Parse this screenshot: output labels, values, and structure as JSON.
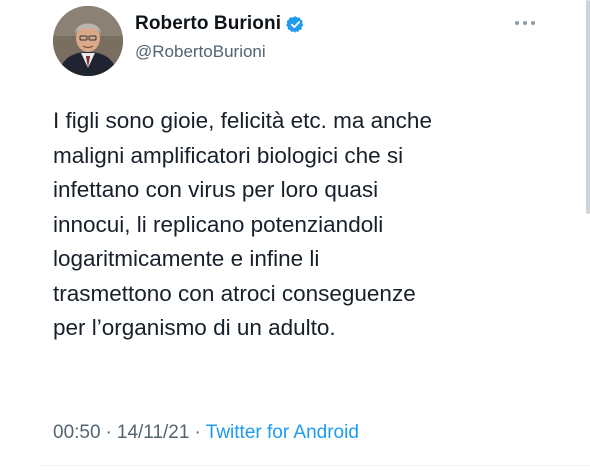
{
  "author": {
    "display_name": "Roberto Burioni",
    "handle": "@RobertoBurioni",
    "verified": true
  },
  "icons": {
    "verified": "verified-badge-icon",
    "more": "more-options-icon"
  },
  "tweet": {
    "text": "I figli sono gioie, felicità etc. ma anche\nmaligni amplificatori biologici che si\ninfettano con virus per loro quasi\ninnocui, li replicano potenziandoli\nlogaritmicamente e infine li\ntrasmettono con atroci conseguenze\nper l’organismo di un adulto."
  },
  "meta": {
    "time": "00:50",
    "separator": "·",
    "date": "14/11/21",
    "source": "Twitter for Android"
  },
  "colors": {
    "text": "#0f1419",
    "secondary": "#536471",
    "accent": "#1d9bf0"
  }
}
